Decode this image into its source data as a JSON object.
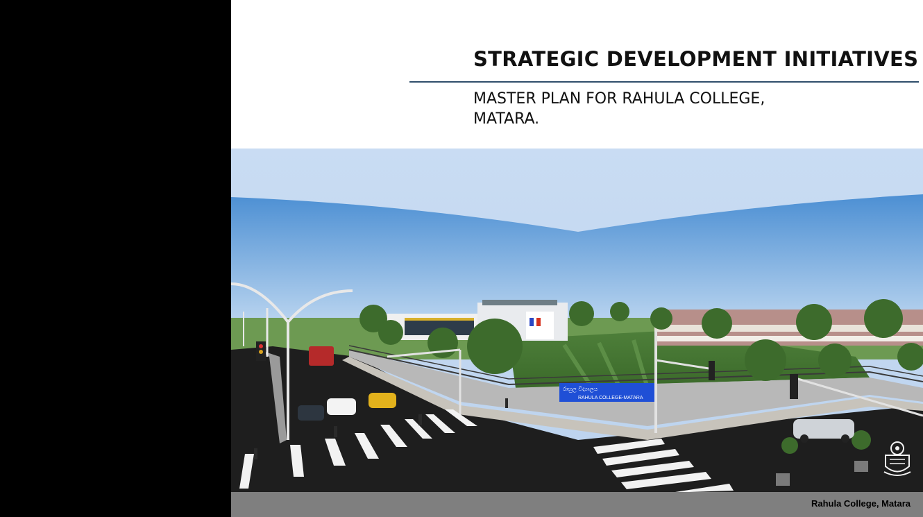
{
  "slide": {
    "title": "STRATEGIC DEVELOPMENT INITIATIVES",
    "subtitle_line1": "MASTER PLAN FOR RAHULA COLLEGE,",
    "subtitle_line2": "MATARA.",
    "footer": "Rahula College, Matara"
  },
  "render": {
    "sign_sinhala": "රාහුල විද්‍යාලය",
    "sign_english": "RAHULA COLLEGE-MATARA"
  },
  "colors": {
    "title_rule": "#2f4e6b",
    "footer_bar": "#7f7f7f",
    "sign_blue": "#1f4fd6"
  }
}
